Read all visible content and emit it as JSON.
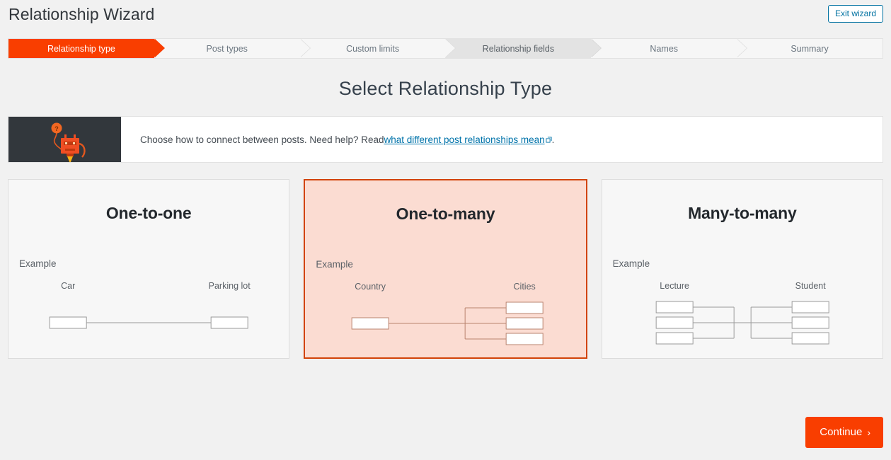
{
  "header": {
    "app_title": "Relationship Wizard",
    "exit_button": "Exit wizard"
  },
  "steps": [
    {
      "label": "Relationship type",
      "state": "active"
    },
    {
      "label": "Post types",
      "state": "default"
    },
    {
      "label": "Custom limits",
      "state": "default"
    },
    {
      "label": "Relationship fields",
      "state": "hovered"
    },
    {
      "label": "Names",
      "state": "default"
    },
    {
      "label": "Summary",
      "state": "default"
    }
  ],
  "page": {
    "heading": "Select Relationship Type"
  },
  "banner": {
    "text_before": "Choose how to connect between posts. Need help? Read ",
    "link_text": "what different post relationships mean",
    "text_after": ".",
    "art_alt": "robot-mascot-illustration"
  },
  "cards": [
    {
      "title": "One-to-one",
      "example_label": "Example",
      "left_label": "Car",
      "right_label": "Parking lot",
      "left_count": 1,
      "right_count": 1,
      "selected": false
    },
    {
      "title": "One-to-many",
      "example_label": "Example",
      "left_label": "Country",
      "right_label": "Cities",
      "left_count": 1,
      "right_count": 3,
      "selected": true
    },
    {
      "title": "Many-to-many",
      "example_label": "Example",
      "left_label": "Lecture",
      "right_label": "Student",
      "left_count": 3,
      "right_count": 3,
      "selected": false
    }
  ],
  "footer": {
    "continue_label": "Continue",
    "continue_chevron": "›"
  },
  "colors": {
    "accent_orange": "#f93e00",
    "selected_border": "#d24309",
    "selected_fill": "#fbdcd2",
    "link_blue": "#0073aa",
    "page_bg": "#f1f1f1",
    "dark_panel": "#32373c"
  }
}
